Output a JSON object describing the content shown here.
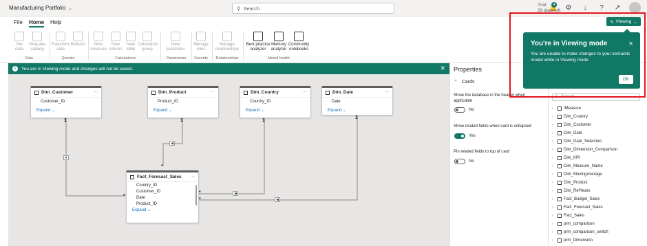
{
  "app": {
    "title": "Manufacturing Portfolio"
  },
  "search": {
    "placeholder": "Search"
  },
  "trial": {
    "line1": "Trial:",
    "line2": "29 days left"
  },
  "notifications": {
    "count": "4"
  },
  "ribbon_tabs": [
    "File",
    "Home",
    "Help"
  ],
  "ribbon": {
    "buttons": [
      {
        "label1": "Get",
        "label2": "data",
        "enabled": false
      },
      {
        "label1": "OneLake",
        "label2": "catalog",
        "enabled": false
      },
      {
        "label1": "Transform",
        "label2": "data",
        "enabled": false
      },
      {
        "label1": "Refresh",
        "label2": "",
        "enabled": false
      },
      {
        "label1": "New",
        "label2": "measure",
        "enabled": false
      },
      {
        "label1": "New",
        "label2": "column",
        "enabled": false
      },
      {
        "label1": "New",
        "label2": "table",
        "enabled": false
      },
      {
        "label1": "Calculation",
        "label2": "group",
        "enabled": false
      },
      {
        "label1": "New",
        "label2": "parameter",
        "enabled": false
      },
      {
        "label1": "Manage",
        "label2": "roles",
        "enabled": false
      },
      {
        "label1": "Manage",
        "label2": "relationships",
        "enabled": false
      },
      {
        "label1": "Best practice",
        "label2": "analyzer",
        "enabled": true
      },
      {
        "label1": "Memory",
        "label2": "analyzer",
        "enabled": true
      },
      {
        "label1": "Community",
        "label2": "notebooks",
        "enabled": true
      }
    ],
    "groups": [
      "Data",
      "Queries",
      "Calculations",
      "Parameters",
      "Security",
      "Relationships",
      "Model health"
    ]
  },
  "infobar": {
    "message": "You are in Viewing mode and changes will not be saved."
  },
  "tables": {
    "dim_customer": {
      "title": "Dim_Customer",
      "fields": [
        "Customer_ID"
      ],
      "expand": "Expand"
    },
    "dim_product": {
      "title": "Dim_Product",
      "fields": [
        "Product_ID"
      ],
      "expand": "Expand"
    },
    "dim_country": {
      "title": "Dim_Country",
      "fields": [
        "Country_ID"
      ],
      "expand": "Expand"
    },
    "dim_date": {
      "title": "Dim_Date",
      "fields": [
        "Date"
      ],
      "expand": "Expand"
    },
    "fact": {
      "title": "Fact_Forecast_Sales",
      "fields": [
        "Country_ID",
        "Customer_ID",
        "Date",
        "Product_ID"
      ],
      "expand": "Expand"
    }
  },
  "relationships": {
    "one": "1",
    "many": "*"
  },
  "properties": {
    "title": "Properties",
    "section": "Cards",
    "opt1_label": "Show the database in the header when applicable",
    "opt1_value": "No",
    "opt2_label": "Show related fields when card is collapsed",
    "opt2_value": "Yes",
    "opt3_label": "Pin related fields to top of card",
    "opt3_value": "No"
  },
  "data_pane": {
    "search_placeholder": "Search",
    "items": [
      "!Measure",
      "Dim_Country",
      "Dim_Customer",
      "Dim_Date",
      "Dim_Date_Selection",
      "Dim_Dimension_Comparison",
      "Dim_KPI",
      "Dim_Measure_Name",
      "Dim_MovingAverage",
      "Dim_Product",
      "Dim_RefYears",
      "Fact_Budget_Sales",
      "Fact_Forecast_Sales",
      "Fact_Sales",
      "prm_comparison",
      "prm_comparison_switch",
      "prm_Dimension"
    ]
  },
  "viewing": {
    "button_label": "Viewing",
    "popup_title": "You're in Viewing mode",
    "popup_body": "You are unable to make changes to your semantic model while in Viewing mode.",
    "ok_label": "OK"
  },
  "colors": {
    "accent": "#117865",
    "highlight_frame": "#e5141b"
  }
}
